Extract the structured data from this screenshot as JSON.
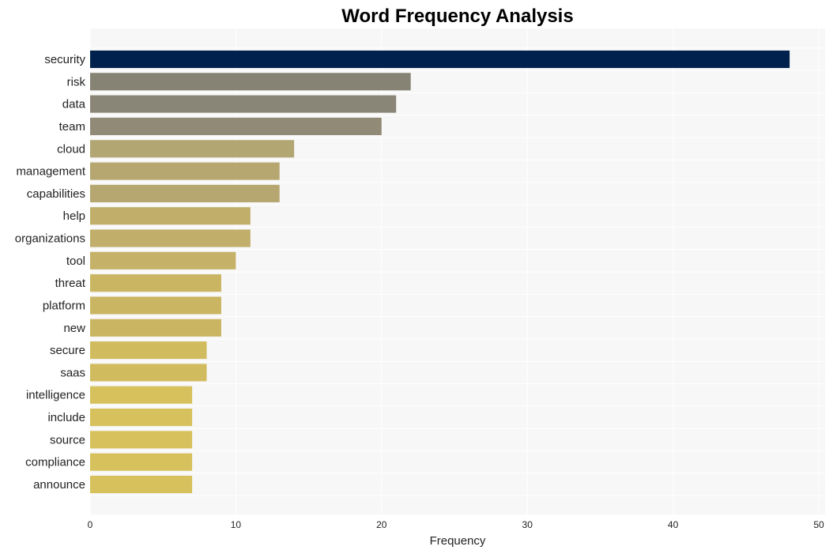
{
  "chart_data": {
    "type": "bar",
    "orientation": "horizontal",
    "title": "Word Frequency Analysis",
    "xlabel": "Frequency",
    "ylabel": "",
    "xlim": [
      0,
      50
    ],
    "xticks": [
      0,
      10,
      20,
      30,
      40,
      50
    ],
    "grid": true,
    "legend": null,
    "categories": [
      "security",
      "risk",
      "data",
      "team",
      "cloud",
      "management",
      "capabilities",
      "help",
      "organizations",
      "tool",
      "threat",
      "platform",
      "new",
      "secure",
      "saas",
      "intelligence",
      "include",
      "source",
      "compliance",
      "announce"
    ],
    "values": [
      48,
      22,
      21,
      20,
      14,
      13,
      13,
      11,
      11,
      10,
      9,
      9,
      9,
      8,
      8,
      7,
      7,
      7,
      7,
      7
    ],
    "colors": [
      "#00214d",
      "#868374",
      "#8a8677",
      "#918a76",
      "#b2a673",
      "#b5a76f",
      "#b5a76f",
      "#c0ae6a",
      "#c0ae6a",
      "#c5b268",
      "#cab563",
      "#cab563",
      "#cab563",
      "#d1bb5f",
      "#d1bb5f",
      "#d6c15c",
      "#d6c15c",
      "#d6c15c",
      "#d6c15c",
      "#d6c15c"
    ],
    "plot_background": "#f7f7f7",
    "grid_color": "#ffffff"
  }
}
